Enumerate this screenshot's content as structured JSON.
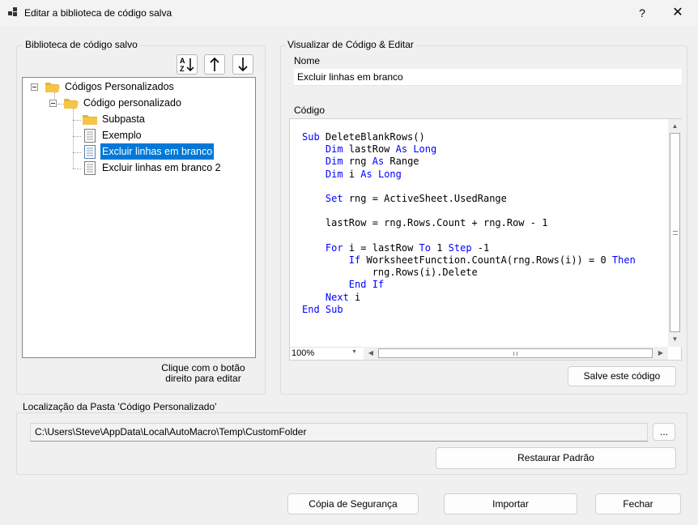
{
  "window": {
    "title": "Editar a biblioteca de código salva",
    "help_label": "?",
    "close_label": "✕"
  },
  "library": {
    "group_label": "Biblioteca de código salvo",
    "sort_icon_label": "A Z ↓",
    "up_label": "↑",
    "down_label": "↓",
    "tree": [
      {
        "label": "Códigos Personalizados",
        "type": "folder"
      },
      {
        "label": "Código personalizado",
        "type": "folder"
      },
      {
        "label": "Subpasta",
        "type": "folder"
      },
      {
        "label": "Exemplo",
        "type": "file"
      },
      {
        "label": "Excluir linhas em branco",
        "type": "file",
        "selected": true
      },
      {
        "label": "Excluir linhas em branco 2",
        "type": "file"
      }
    ],
    "hint_line1": "Clique com o botão",
    "hint_line2": "direito para editar"
  },
  "editor": {
    "group_label": "Visualizar de Código & Editar",
    "name_label": "Nome",
    "name_value": "Excluir linhas em branco",
    "code_label": "Código",
    "code_lines": [
      "Sub DeleteBlankRows()",
      "    Dim lastRow As Long",
      "    Dim rng As Range",
      "    Dim i As Long",
      "",
      "    Set rng = ActiveSheet.UsedRange",
      "",
      "    lastRow = rng.Rows.Count + rng.Row - 1",
      "",
      "    For i = lastRow To 1 Step -1",
      "        If WorksheetFunction.CountA(rng.Rows(i)) = 0 Then",
      "            rng.Rows(i).Delete",
      "        End If",
      "    Next i",
      "End Sub"
    ],
    "zoom": "100%",
    "save_button": "Salve este código"
  },
  "location": {
    "group_label": "Localização da Pasta 'Código Personalizado'",
    "path": "C:\\Users\\Steve\\AppData\\Local\\AutoMacro\\Temp\\CustomFolder",
    "browse_label": "...",
    "restore_button": "Restaurar Padrão"
  },
  "footer": {
    "backup_button": "Cópia de Segurança",
    "import_button": "Importar",
    "close_button": "Fechar"
  },
  "colors": {
    "selection": "#0078d7",
    "keyword": "#0000ff",
    "folder": "#f6c544"
  }
}
